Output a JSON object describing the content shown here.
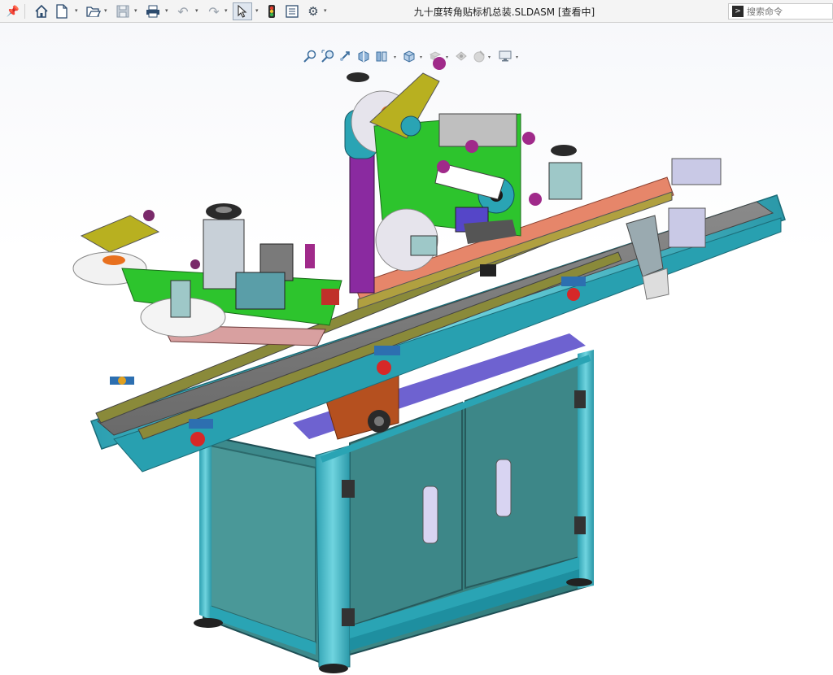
{
  "toolbar": {
    "pin": "📌",
    "home": "⌂",
    "new": "🗋",
    "open": "📂",
    "save": "💾",
    "print": "🖶",
    "undo": "↶",
    "redo": "↷",
    "select": "⬉",
    "traffic": "🚦",
    "options_list": "☷",
    "settings": "⚙",
    "caret": "▾"
  },
  "window": {
    "title": "九十度转角贴标机总装.SLDASM [查看中]"
  },
  "search": {
    "placeholder": "搜索命令",
    "icon": ">"
  },
  "view_toolbar": {
    "caret": "▾",
    "zoom_fit": "⌕",
    "zoom_area": "⌕",
    "previous_view": "↩",
    "section_view": "▤",
    "view_orientation": "◧",
    "display_style": "◩",
    "hide_show": "◈",
    "edit_appearance": "◆",
    "apply_scene": "◍",
    "view_settings": "▭"
  },
  "model": {
    "name": "九十度转角贴标机总装",
    "colors": {
      "cabinet": "#3f8e8e",
      "frame": "#2aa4b4",
      "belt": "#7a7a7a",
      "rail": "#8a8a3a",
      "green_plate": "#2dc42d",
      "purple": "#8a2aa0",
      "orange_belt": "#e6866a"
    }
  }
}
